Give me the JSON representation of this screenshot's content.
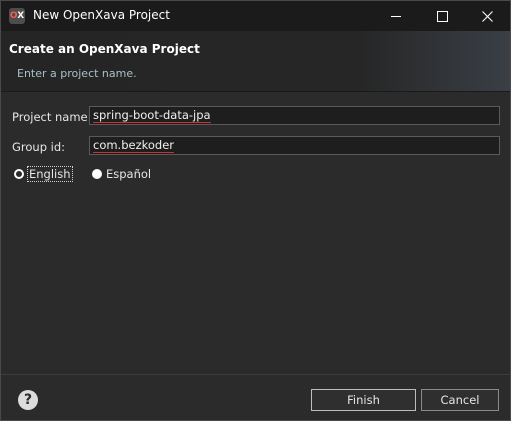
{
  "window": {
    "title": "New OpenXava Project",
    "app_icon_left": "O",
    "app_icon_right": "X"
  },
  "header": {
    "title": "Create an OpenXava Project",
    "subtitle": "Enter a project name."
  },
  "form": {
    "project_name_label": "Project name:",
    "project_name_value": "spring-boot-data-jpa",
    "group_id_label": "Group id:",
    "group_id_value": "com.bezkoder",
    "languages": [
      {
        "label": "English",
        "selected": true
      },
      {
        "label": "Español",
        "selected": false
      }
    ]
  },
  "footer": {
    "help_glyph": "?",
    "finish_label": "Finish",
    "cancel_label": "Cancel"
  },
  "icons": {
    "minimize": "minimize-icon",
    "maximize": "maximize-icon",
    "close": "close-icon",
    "help": "help-icon"
  }
}
